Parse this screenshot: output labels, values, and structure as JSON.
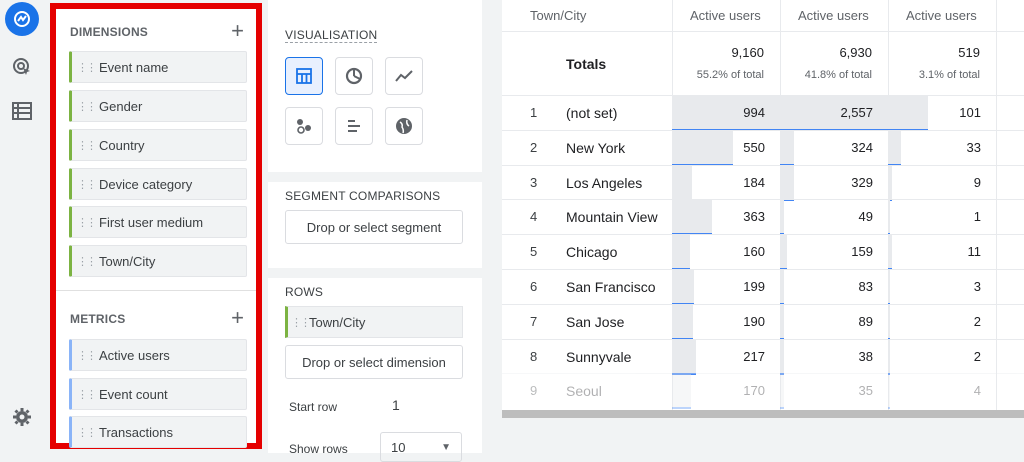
{
  "dimensions": {
    "title": "DIMENSIONS",
    "add_icon": "plus-icon",
    "items": [
      "Event name",
      "Gender",
      "Country",
      "Device category",
      "First user medium",
      "Town/City"
    ]
  },
  "metrics": {
    "title": "METRICS",
    "add_icon": "plus-icon",
    "items": [
      "Active users",
      "Event count",
      "Transactions"
    ]
  },
  "settings": {
    "visualisation_title": "VISUALISATION",
    "visualisation_icons": [
      "table-icon",
      "donut-chart-icon",
      "line-chart-icon",
      "scatter-plot-icon",
      "bar-chart-icon",
      "geo-map-icon"
    ],
    "segment_title": "SEGMENT COMPARISONS",
    "segment_placeholder": "Drop or select segment",
    "rows_title": "ROWS",
    "rows_dimension": "Town/City",
    "rows_placeholder": "Drop or select dimension",
    "start_row_label": "Start row",
    "start_row_value": "1",
    "show_rows_label": "Show rows",
    "show_rows_value": "10"
  },
  "table": {
    "dimension_header": "Town/City",
    "metric_headers": [
      "Active users",
      "Active users",
      "Active users"
    ],
    "totals_label": "Totals",
    "totals": [
      {
        "value": "9,160",
        "pct": "55.2% of total"
      },
      {
        "value": "6,930",
        "pct": "41.8% of total"
      },
      {
        "value": "519",
        "pct": "3.1% of total"
      }
    ],
    "rows": [
      {
        "n": "1",
        "city": "(not set)",
        "v": [
          "994",
          "2,557",
          "101"
        ]
      },
      {
        "n": "2",
        "city": "New York",
        "v": [
          "550",
          "324",
          "33"
        ]
      },
      {
        "n": "3",
        "city": "Los Angeles",
        "v": [
          "184",
          "329",
          "9"
        ]
      },
      {
        "n": "4",
        "city": "Mountain View",
        "v": [
          "363",
          "49",
          "1"
        ]
      },
      {
        "n": "5",
        "city": "Chicago",
        "v": [
          "160",
          "159",
          "11"
        ]
      },
      {
        "n": "6",
        "city": "San Francisco",
        "v": [
          "199",
          "83",
          "3"
        ]
      },
      {
        "n": "7",
        "city": "San Jose",
        "v": [
          "190",
          "89",
          "2"
        ]
      },
      {
        "n": "8",
        "city": "Sunnyvale",
        "v": [
          "217",
          "38",
          "2"
        ]
      },
      {
        "n": "9",
        "city": "Seoul",
        "v": [
          "170",
          "35",
          "4"
        ]
      }
    ]
  },
  "colors": {
    "highlight_border": "#e50000",
    "dimension_accent": "#7cb342",
    "metric_accent": "#8ab4f8",
    "bar_underline": "#4285f4",
    "logo_blue": "#1a73e8"
  }
}
